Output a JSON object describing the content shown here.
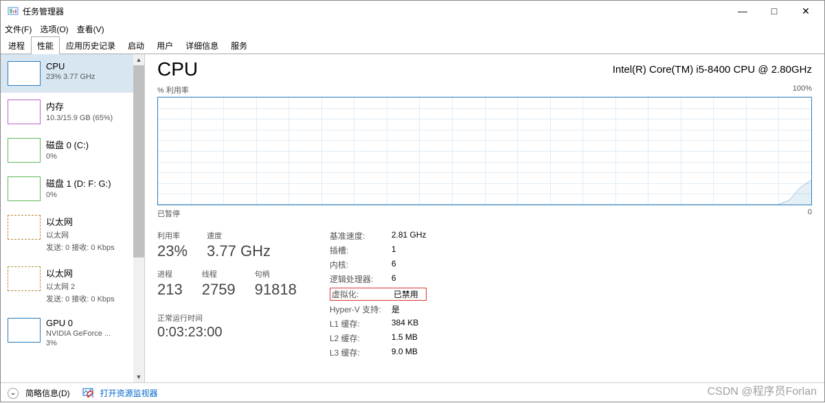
{
  "window": {
    "title": "任务管理器",
    "controls": {
      "min": "—",
      "max": "□",
      "close": "✕"
    }
  },
  "menu": {
    "file": "文件(F)",
    "options": "选项(O)",
    "view": "查看(V)"
  },
  "tabs": {
    "processes": "进程",
    "performance": "性能",
    "app_history": "应用历史记录",
    "startup": "启动",
    "users": "用户",
    "details": "详细信息",
    "services": "服务"
  },
  "sidebar": [
    {
      "title": "CPU",
      "sub": "23% 3.77 GHz",
      "kind": "cpu",
      "selected": true
    },
    {
      "title": "内存",
      "sub": "10.3/15.9 GB (65%)",
      "kind": "mem"
    },
    {
      "title": "磁盘 0 (C:)",
      "sub": "0%",
      "kind": "disk"
    },
    {
      "title": "磁盘 1 (D: F: G:)",
      "sub": "0%",
      "kind": "disk"
    },
    {
      "title": "以太网",
      "sub": "以太网",
      "sub2": "发送: 0 接收: 0 Kbps",
      "kind": "eth"
    },
    {
      "title": "以太网",
      "sub": "以太网 2",
      "sub2": "发送: 0 接收: 0 Kbps",
      "kind": "eth"
    },
    {
      "title": "GPU 0",
      "sub": "NVIDIA GeForce ...",
      "sub2": "3%",
      "kind": "gpu"
    }
  ],
  "main": {
    "title": "CPU",
    "model": "Intel(R) Core(TM) i5-8400 CPU @ 2.80GHz",
    "chart_top_left": "% 利用率",
    "chart_top_right": "100%",
    "chart_bottom_left": "已暂停",
    "chart_bottom_right": "0",
    "stats_big": [
      {
        "label": "利用率",
        "value": "23%"
      },
      {
        "label": "速度",
        "value": "3.77 GHz"
      }
    ],
    "stats_big2": [
      {
        "label": "进程",
        "value": "213"
      },
      {
        "label": "线程",
        "value": "2759"
      },
      {
        "label": "句柄",
        "value": "91818"
      }
    ],
    "uptime_label": "正常运行时间",
    "uptime_value": "0:03:23:00",
    "details": [
      {
        "k": "基准速度:",
        "v": "2.81 GHz"
      },
      {
        "k": "插槽:",
        "v": "1"
      },
      {
        "k": "内核:",
        "v": "6"
      },
      {
        "k": "逻辑处理器:",
        "v": "6"
      },
      {
        "k": "虚拟化:",
        "v": "已禁用",
        "highlight": true
      },
      {
        "k": "Hyper-V 支持:",
        "v": "是"
      },
      {
        "k": "L1 缓存:",
        "v": "384 KB"
      },
      {
        "k": "L2 缓存:",
        "v": "1.5 MB"
      },
      {
        "k": "L3 缓存:",
        "v": "9.0 MB"
      }
    ]
  },
  "footer": {
    "brief": "简略信息(D)",
    "resmon": "打开资源监视器"
  },
  "chart_data": {
    "type": "line",
    "title": "% 利用率",
    "ylabel": "",
    "ylim": [
      0,
      100
    ],
    "x": [
      0,
      1,
      2,
      3,
      4,
      5,
      6,
      7,
      8,
      9,
      10,
      11,
      12,
      13,
      14,
      15,
      16,
      17,
      18,
      19,
      20,
      21,
      22,
      23,
      24,
      25,
      26,
      27,
      28,
      29,
      30,
      31,
      32,
      33,
      34,
      35,
      36,
      37,
      38,
      39,
      40,
      41,
      42,
      43,
      44,
      45,
      46,
      47,
      48,
      49,
      50,
      51,
      52,
      53,
      54,
      55,
      56,
      57,
      58,
      59
    ],
    "values": [
      0,
      0,
      0,
      0,
      0,
      0,
      0,
      0,
      0,
      0,
      0,
      0,
      0,
      0,
      0,
      0,
      0,
      0,
      0,
      0,
      0,
      0,
      0,
      0,
      0,
      0,
      0,
      0,
      0,
      0,
      0,
      0,
      0,
      0,
      0,
      0,
      0,
      0,
      0,
      0,
      0,
      0,
      0,
      0,
      0,
      0,
      0,
      0,
      0,
      0,
      0,
      0,
      0,
      0,
      0,
      0,
      0,
      4,
      16,
      23
    ]
  },
  "watermark": "CSDN @程序员Forlan"
}
